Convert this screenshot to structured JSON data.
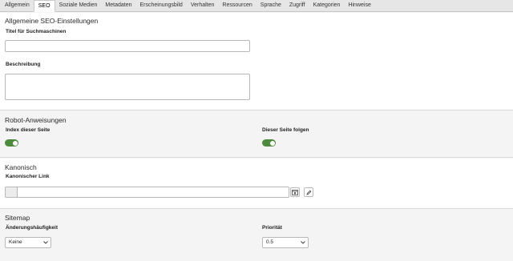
{
  "tabs": [
    "Allgemein",
    "SEO",
    "Soziale Medien",
    "Metadaten",
    "Erscheinungsbild",
    "Verhalten",
    "Ressourcen",
    "Sprache",
    "Zugriff",
    "Kategorien",
    "Hinweise"
  ],
  "active_tab": "SEO",
  "seo": {
    "title": "Allgemeine SEO-Einstellungen",
    "seo_title_label": "Titel für Suchmaschinen",
    "seo_title_value": "",
    "description_label": "Beschreibung",
    "description_value": ""
  },
  "robots": {
    "title": "Robot-Anweisungen",
    "index_label": "Index dieser Seite",
    "index_enabled": true,
    "follow_label": "Dieser Seite folgen",
    "follow_enabled": true
  },
  "canonical": {
    "title": "Kanonisch",
    "link_label": "Kanonischer Link",
    "link_value": ""
  },
  "sitemap": {
    "title": "Sitemap",
    "frequency_label": "Änderungshäufigkeit",
    "frequency_value": "Keine",
    "priority_label": "Priorität",
    "priority_value": "0.5"
  },
  "colors": {
    "toggle_on": "#4e8a3e",
    "tab_bar": "#e6e6e6"
  }
}
